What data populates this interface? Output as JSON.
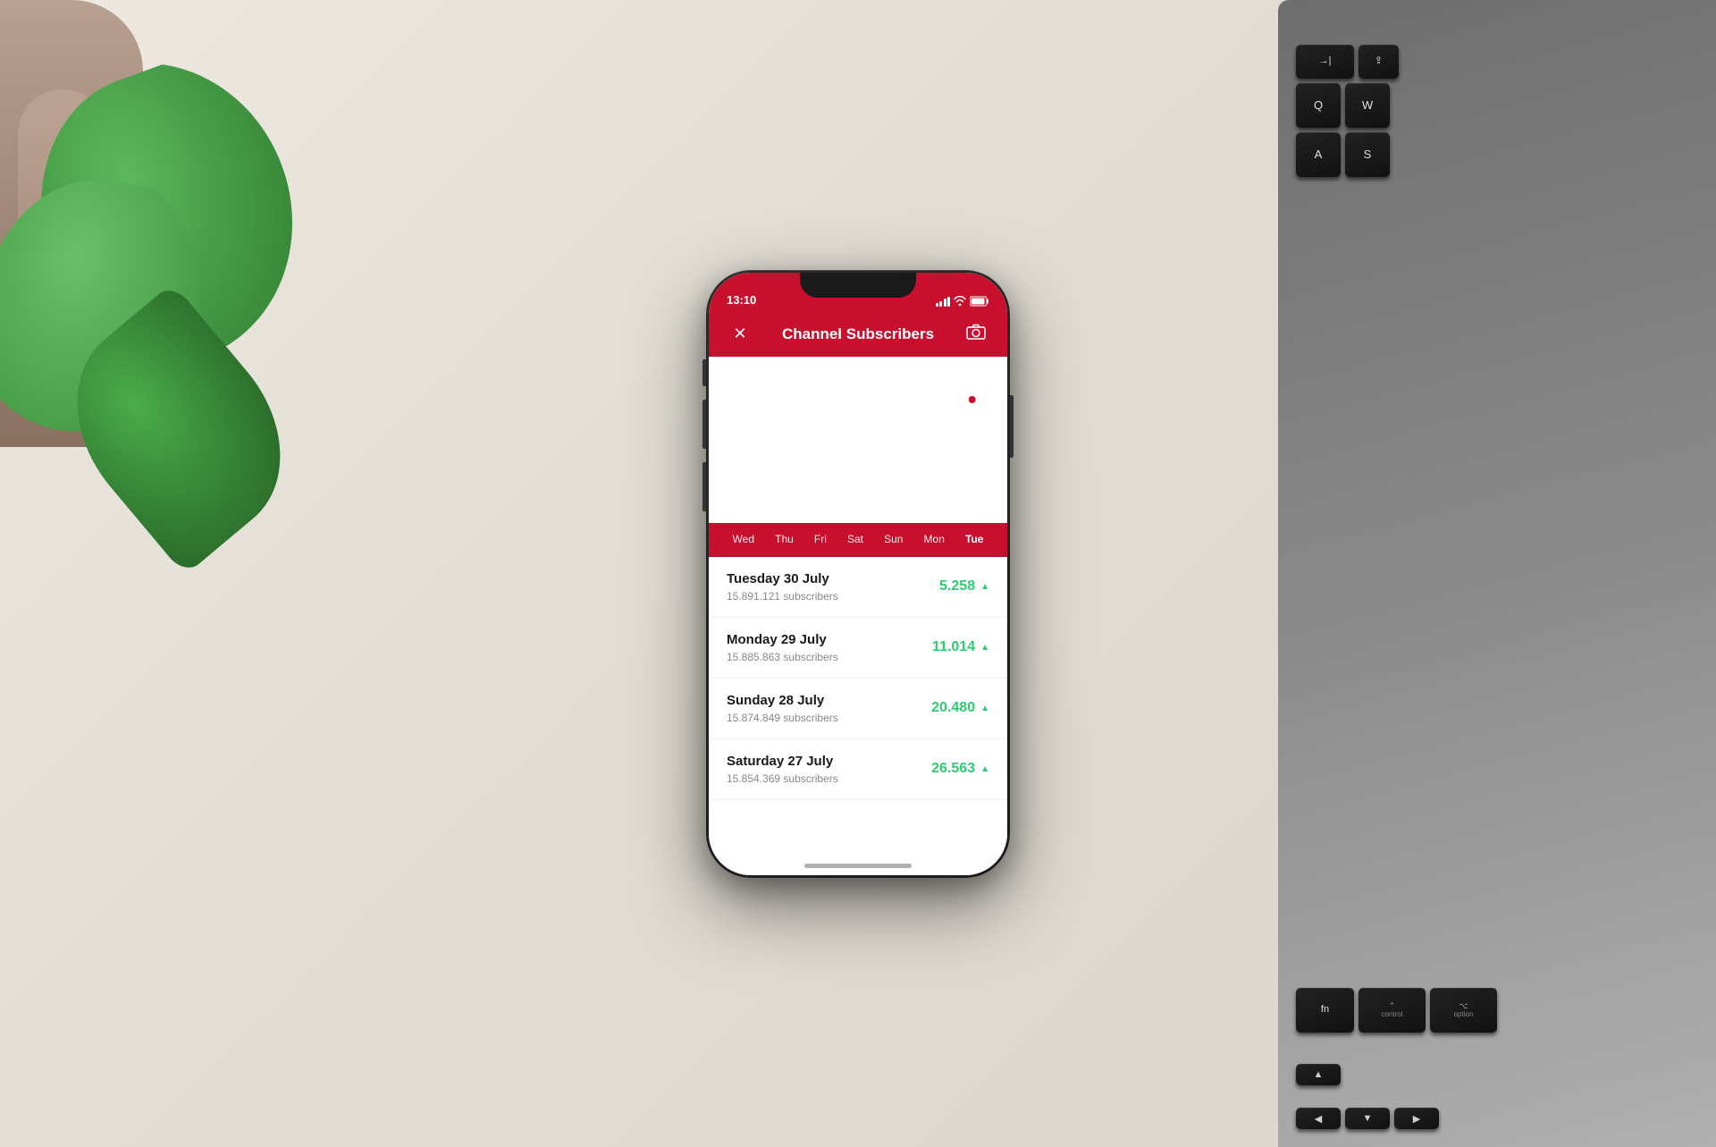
{
  "background": {
    "color": "#e8e4db"
  },
  "phone": {
    "status_bar": {
      "time": "13:10",
      "signal": "signal",
      "wifi": "wifi",
      "battery": "battery"
    },
    "header": {
      "title": "Channel Subscribers",
      "close_label": "×",
      "camera_label": "📷"
    },
    "stats": {
      "number": "15.891.121",
      "date": "Tuesday 30 July"
    },
    "day_labels": [
      "Wed",
      "Thu",
      "Fri",
      "Sat",
      "Sun",
      "Mon",
      "Tue"
    ],
    "list_items": [
      {
        "title": "Tuesday 30 July",
        "subscribers": "15.891.121 subscribers",
        "value": "5.258",
        "trend": "up"
      },
      {
        "title": "Monday 29 July",
        "subscribers": "15.885.863 subscribers",
        "value": "11.014",
        "trend": "up"
      },
      {
        "title": "Sunday 28 July",
        "subscribers": "15.874.849 subscribers",
        "value": "20.480",
        "trend": "up"
      },
      {
        "title": "Saturday 27 July",
        "subscribers": "15.854.369 subscribers",
        "value": "26.563",
        "trend": "up"
      }
    ]
  },
  "keyboard": {
    "rows": [
      [
        {
          "top": "",
          "main": "→|",
          "sub": ""
        },
        {
          "top": "",
          "main": "Q",
          "sub": ""
        },
        {
          "top": "",
          "main": "W",
          "sub": ""
        }
      ],
      [
        {
          "top": "",
          "main": "⇧",
          "sub": ""
        },
        {
          "top": "",
          "main": "A",
          "sub": ""
        },
        {
          "top": "",
          "main": "S",
          "sub": ""
        }
      ],
      [
        {
          "top": "",
          "main": "fn",
          "sub": ""
        },
        {
          "top": "",
          "main": "control",
          "sub": ""
        },
        {
          "top": "",
          "main": "option",
          "sub": ""
        }
      ]
    ]
  }
}
